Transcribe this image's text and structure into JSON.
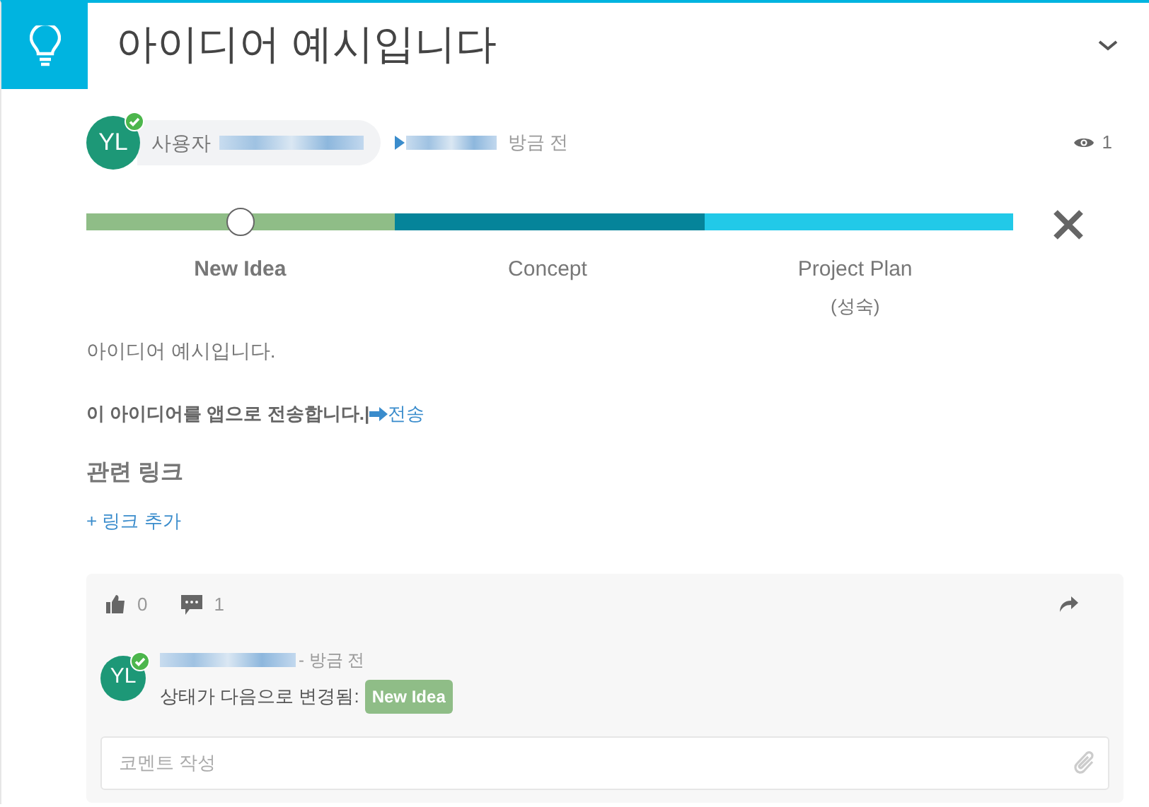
{
  "header": {
    "title": "아이디어 예시입니다"
  },
  "meta": {
    "author_label": "사용자",
    "verified": true,
    "time": "방금 전",
    "views": "1"
  },
  "stages": [
    {
      "label": "New Idea",
      "selected": true,
      "color": "#8fbd87"
    },
    {
      "label": "Concept",
      "selected": false,
      "color": "#05849a"
    },
    {
      "label": "Project Plan",
      "sub": "(성숙)",
      "selected": false,
      "color": "#22c9e8"
    }
  ],
  "description": "아이디어 예시입니다.",
  "transfer": {
    "text": "이 아이디어를 앱으로 전송합니다.",
    "separator": "|",
    "link": "전송"
  },
  "related": {
    "heading": "관련 링크",
    "add": "+ 링크 추가"
  },
  "activity": {
    "likes": "0",
    "comments": "1",
    "entries": [
      {
        "verified": true,
        "avatar": "YL",
        "time": "- 방금 전",
        "text": "상태가 다음으로 변경됨:",
        "badge": "New Idea",
        "color": "#8fbd87"
      }
    ],
    "comment_field": {
      "placeholder": "코멘트 작성"
    }
  },
  "avatar": "YL"
}
